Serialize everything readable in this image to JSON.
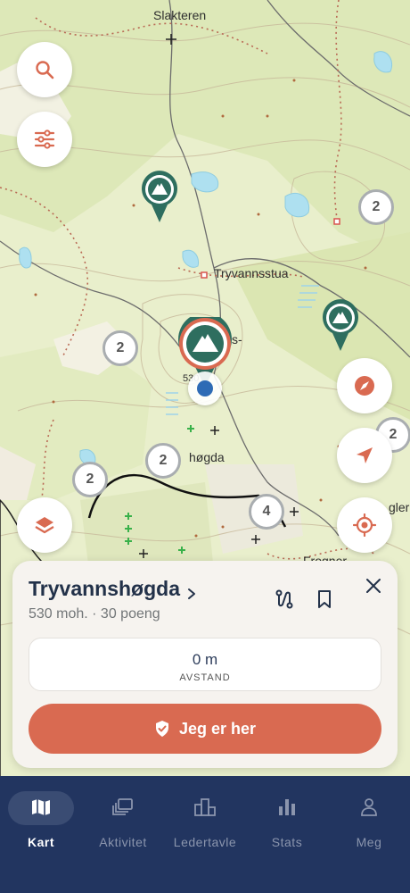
{
  "map": {
    "labels": {
      "slakteren": "Slakteren",
      "tryvannsstua": "Tryvannsstua",
      "hogda": "høgda",
      "s_dash": "s-",
      "elev": "530",
      "frogner": "Frogner",
      "gler": "gler"
    },
    "clusters": {
      "c1": "2",
      "c2": "2",
      "c3": "2",
      "c4": "2",
      "c5": "4",
      "c6": "2"
    }
  },
  "place": {
    "name": "Tryvannshøgda",
    "meta": "530 moh. · 30 poeng",
    "distance_value": "0 m",
    "distance_label": "AVSTAND",
    "checkin_label": "Jeg er her"
  },
  "tabs": [
    {
      "label": "Kart",
      "icon": "map-icon"
    },
    {
      "label": "Aktivitet",
      "icon": "activity-icon"
    },
    {
      "label": "Ledertavle",
      "icon": "leaderboard-icon"
    },
    {
      "label": "Stats",
      "icon": "stats-icon"
    },
    {
      "label": "Meg",
      "icon": "person-icon"
    }
  ],
  "colors": {
    "accent": "#d96a51",
    "nav": "#223560",
    "pin": "#2e6e5f"
  }
}
